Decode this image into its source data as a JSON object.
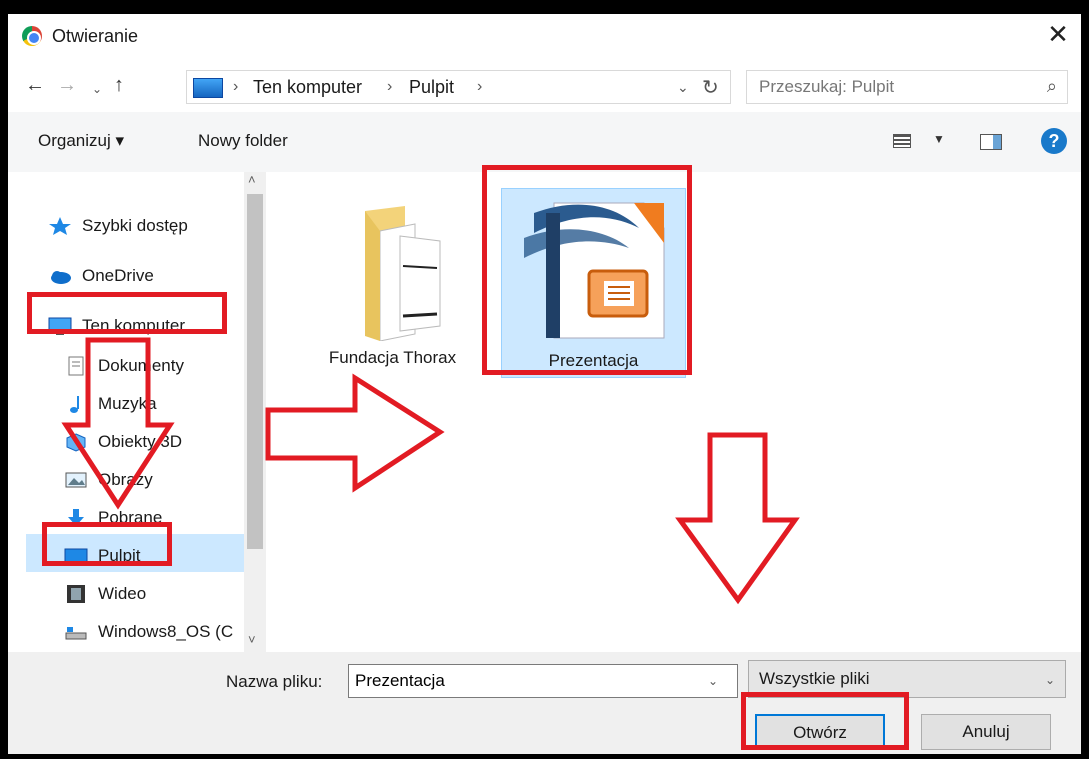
{
  "window": {
    "title": "Otwieranie",
    "close_glyph": "✕"
  },
  "nav": {
    "back_glyph": "←",
    "forward_glyph": "→",
    "recent_glyph": "⌄",
    "up_glyph": "↑",
    "breadcrumbs": [
      "Ten komputer",
      "Pulpit"
    ],
    "crumb_sep": "›",
    "dropdown_glyph": "⌄",
    "refresh_glyph": "↻",
    "search_placeholder": "Przeszukaj: Pulpit",
    "search_glyph": "⌕"
  },
  "toolbar": {
    "organize_label": "Organizuj ▾",
    "new_folder_label": "Nowy folder",
    "view_dropdown_glyph": "▼",
    "help_glyph": "?"
  },
  "sidebar": {
    "items": [
      {
        "label": "Szybki dostęp",
        "icon": "star-icon"
      },
      {
        "label": "OneDrive",
        "icon": "cloud-icon"
      },
      {
        "label": "Ten komputer",
        "icon": "computer-icon"
      },
      {
        "label": "Dokumenty",
        "icon": "documents-icon"
      },
      {
        "label": "Muzyka",
        "icon": "music-icon"
      },
      {
        "label": "Obiekty 3D",
        "icon": "cube-icon"
      },
      {
        "label": "Obrazy",
        "icon": "pictures-icon"
      },
      {
        "label": "Pobrane",
        "icon": "download-icon"
      },
      {
        "label": "Pulpit",
        "icon": "desktop-icon"
      },
      {
        "label": "Wideo",
        "icon": "video-icon"
      },
      {
        "label": "Windows8_OS (C",
        "icon": "drive-icon"
      }
    ],
    "scroll_up_glyph": "˄",
    "scroll_down_glyph": "˅"
  },
  "files": [
    {
      "name": "Fundacja Thorax",
      "type": "folder"
    },
    {
      "name": "Prezentacja",
      "type": "presentation",
      "selected": true
    }
  ],
  "bottom": {
    "filename_label": "Nazwa pliku:",
    "filename_value": "Prezentacja",
    "dropdown_glyph": "⌄",
    "filetype_label": "Wszystkie pliki",
    "filetype_chevron": "⌄",
    "open_label": "Otwórz",
    "cancel_label": "Anuluj"
  },
  "colors": {
    "annotation_red": "#e21b23",
    "selection_blue": "#cce8ff",
    "accent": "#0078d7"
  }
}
